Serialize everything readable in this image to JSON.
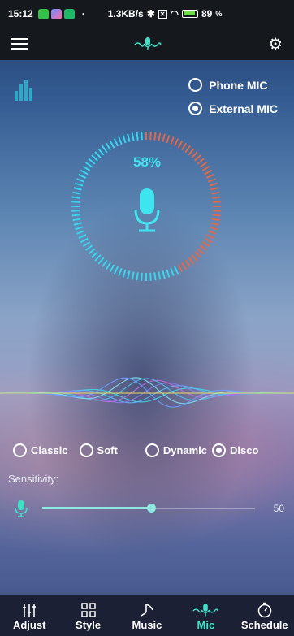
{
  "status_bar": {
    "time": "15:12",
    "speed": "1.3KB/s",
    "battery": "89",
    "battery_unit": "%"
  },
  "mic_source": {
    "options": [
      {
        "label": "Phone MIC",
        "selected": false
      },
      {
        "label": "External MIC",
        "selected": true
      }
    ]
  },
  "gauge": {
    "percent_text": "58%",
    "level": 0.58,
    "colors": {
      "low": "#36d6ee",
      "high": "#e0694a"
    }
  },
  "styles": {
    "options": [
      {
        "label": "Classic",
        "selected": false
      },
      {
        "label": "Soft",
        "selected": false
      },
      {
        "label": "Dynamic",
        "selected": false
      },
      {
        "label": "Disco",
        "selected": true
      }
    ]
  },
  "sensitivity": {
    "label": "Sensitivity:",
    "value": "50",
    "level": 0.5
  },
  "tabs": [
    {
      "label": "Adjust",
      "icon": "sliders-icon",
      "active": false
    },
    {
      "label": "Style",
      "icon": "grid-icon",
      "active": false
    },
    {
      "label": "Music",
      "icon": "music-note-icon",
      "active": false
    },
    {
      "label": "Mic",
      "icon": "mic-icon",
      "active": true
    },
    {
      "label": "Schedule",
      "icon": "timer-icon",
      "active": false
    }
  ],
  "accent_color": "#3fe0c7"
}
